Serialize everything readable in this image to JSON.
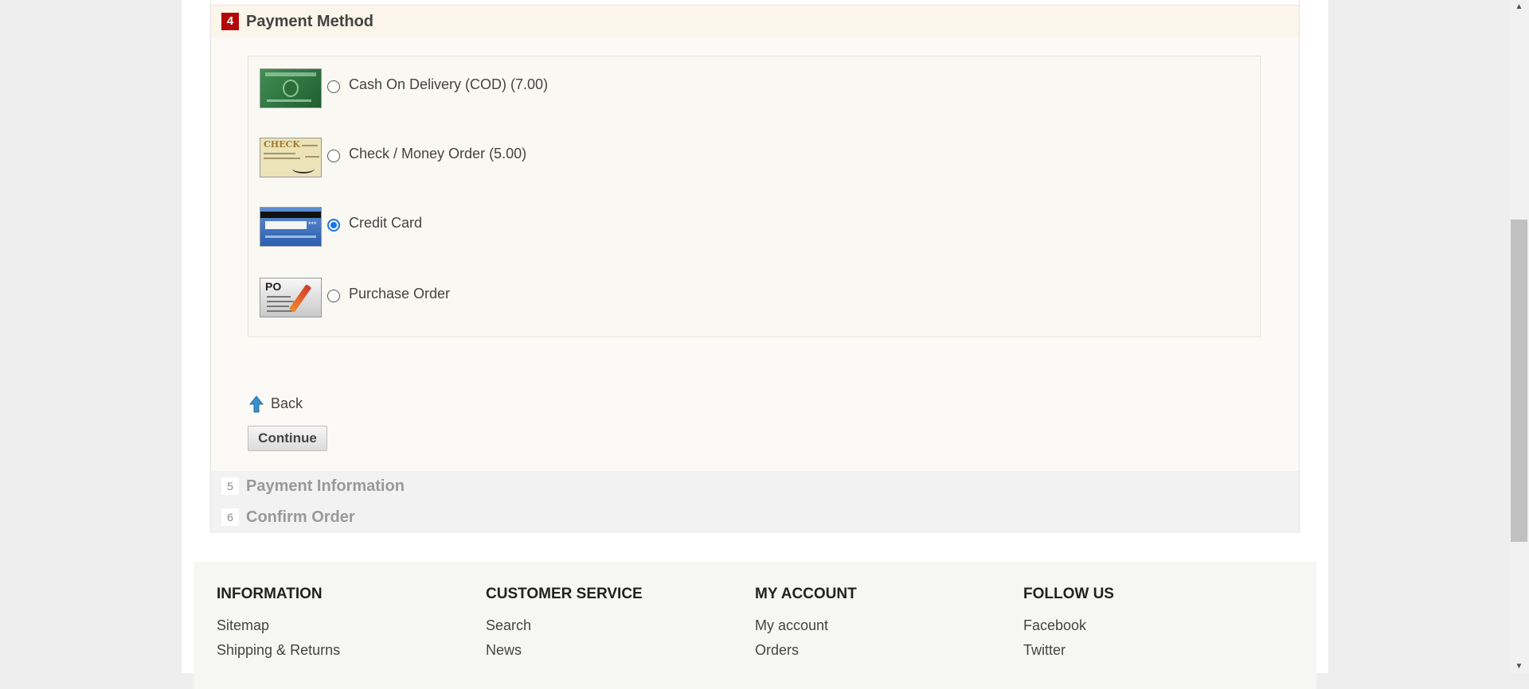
{
  "checkout": {
    "payment_method": {
      "step_number": "4",
      "title": "Payment Method",
      "methods": [
        {
          "label": "Cash On Delivery (COD) (7.00)",
          "image": "cash-on-delivery-card",
          "selected": false
        },
        {
          "label": "Check / Money Order (5.00)",
          "image": "check",
          "selected": false
        },
        {
          "label": "Credit Card",
          "image": "credit-card",
          "selected": true
        },
        {
          "label": "Purchase Order",
          "image": "purchase-order",
          "selected": false
        }
      ],
      "check_image_text": "CHECK",
      "po_image_text": "PO",
      "back_label": "Back",
      "back_icon": "arrow-up-icon",
      "continue_label": "Continue"
    },
    "payment_information": {
      "step_number": "5",
      "title": "Payment Information"
    },
    "confirm_order": {
      "step_number": "6",
      "title": "Confirm Order"
    }
  },
  "footer": {
    "information": {
      "heading": "INFORMATION",
      "links": [
        "Sitemap",
        "Shipping & Returns"
      ]
    },
    "customer_service": {
      "heading": "CUSTOMER SERVICE",
      "links": [
        "Search",
        "News"
      ]
    },
    "my_account": {
      "heading": "MY ACCOUNT",
      "links": [
        "My account",
        "Orders"
      ]
    },
    "follow_us": {
      "heading": "FOLLOW US",
      "links": [
        "Facebook",
        "Twitter"
      ]
    }
  },
  "colors": {
    "accent": "#b30808",
    "selected_radio": "#1a73e8",
    "active_step_bg": "#fbf5ea",
    "inactive_step_bg": "#f2f2f2"
  }
}
